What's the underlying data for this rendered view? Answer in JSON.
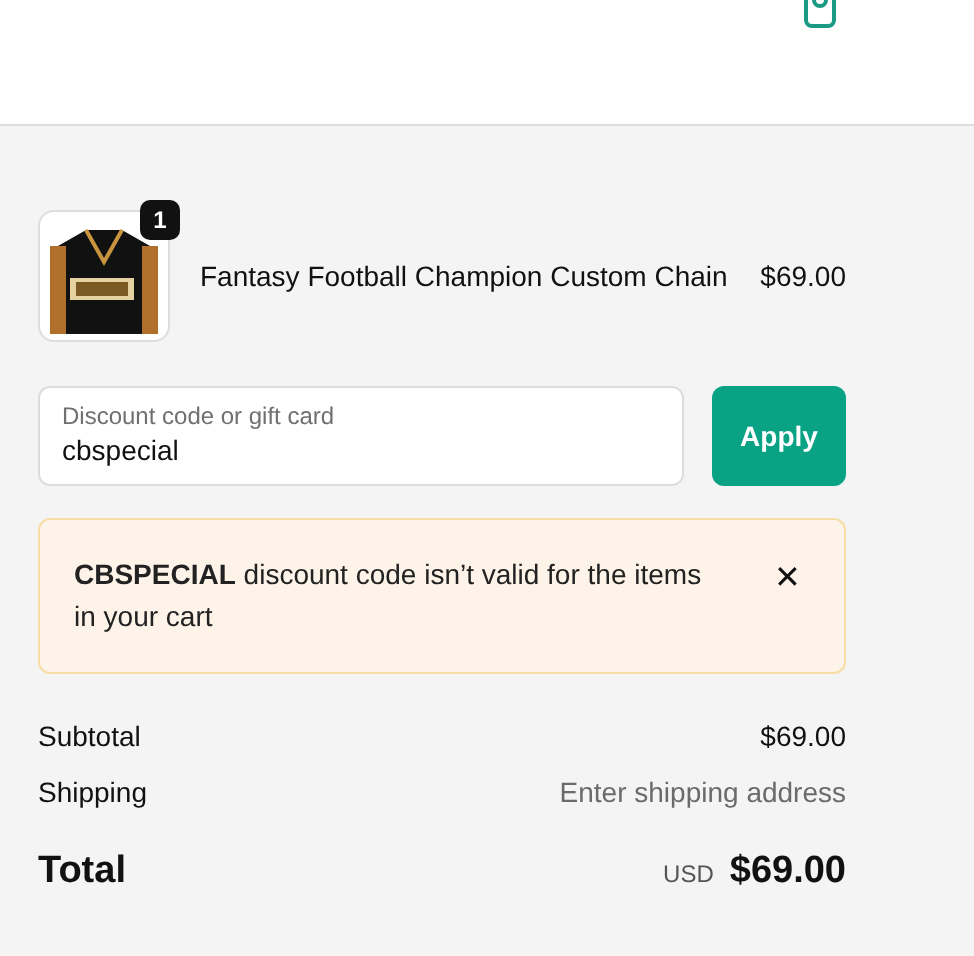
{
  "cart_item": {
    "quantity": "1",
    "name": "Fantasy Football Champion Custom Chain",
    "price": "$69.00"
  },
  "discount": {
    "placeholder": "Discount code or gift card",
    "value": "cbspecial",
    "button": "Apply"
  },
  "alert": {
    "message": "**CBSPECIAL** discount code isn’t valid for the items in your cart",
    "close": "✕"
  },
  "summary": [
    {
      "label": "Subtotal",
      "value": "$69.00",
      "kind": "amount"
    },
    {
      "label": "Shipping",
      "value": "Enter shipping address",
      "kind": "hint"
    }
  ],
  "total": {
    "label": "Total",
    "currency": "USD",
    "value": "$69.00"
  }
}
